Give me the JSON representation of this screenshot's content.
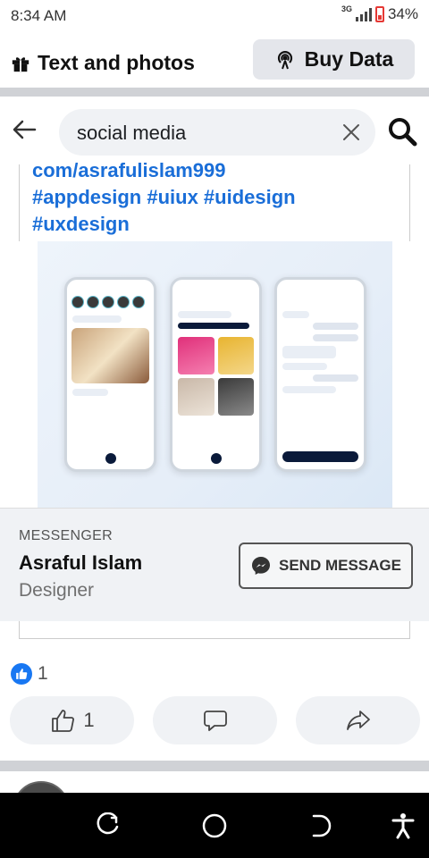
{
  "status_bar": {
    "time": "8:34 AM",
    "network": "3G",
    "battery": "34%"
  },
  "topbar": {
    "left_icon": "gift-icon",
    "left_label": "Text and photos",
    "buy_icon": "broadcast-icon",
    "buy_label": "Buy Data"
  },
  "search": {
    "back_icon": "back-arrow-icon",
    "query": "social media",
    "clear_icon": "close-icon",
    "search_icon": "search-icon"
  },
  "post": {
    "link_line": "com/asrafulislam999",
    "hashtags_line1": "#appdesign #uiux #uidesign",
    "hashtags_line2": "#uxdesign",
    "image_label": "three mobile app screens mockup"
  },
  "messenger_card": {
    "kicker": "MESSENGER",
    "name": "Asraful Islam",
    "role": "Designer",
    "button_icon": "messenger-icon",
    "button_label": "SEND MESSAGE"
  },
  "reactions": {
    "icon": "like-badge-icon",
    "count": "1"
  },
  "actions": {
    "like_count": "1",
    "like_icon": "thumbs-up-icon",
    "comment_icon": "comment-icon",
    "share_icon": "share-icon"
  },
  "colors": {
    "link_blue": "#1a6ed8",
    "like_blue": "#1877f2",
    "pill_bg": "#f0f2f5",
    "divider": "#d0d2d6"
  }
}
